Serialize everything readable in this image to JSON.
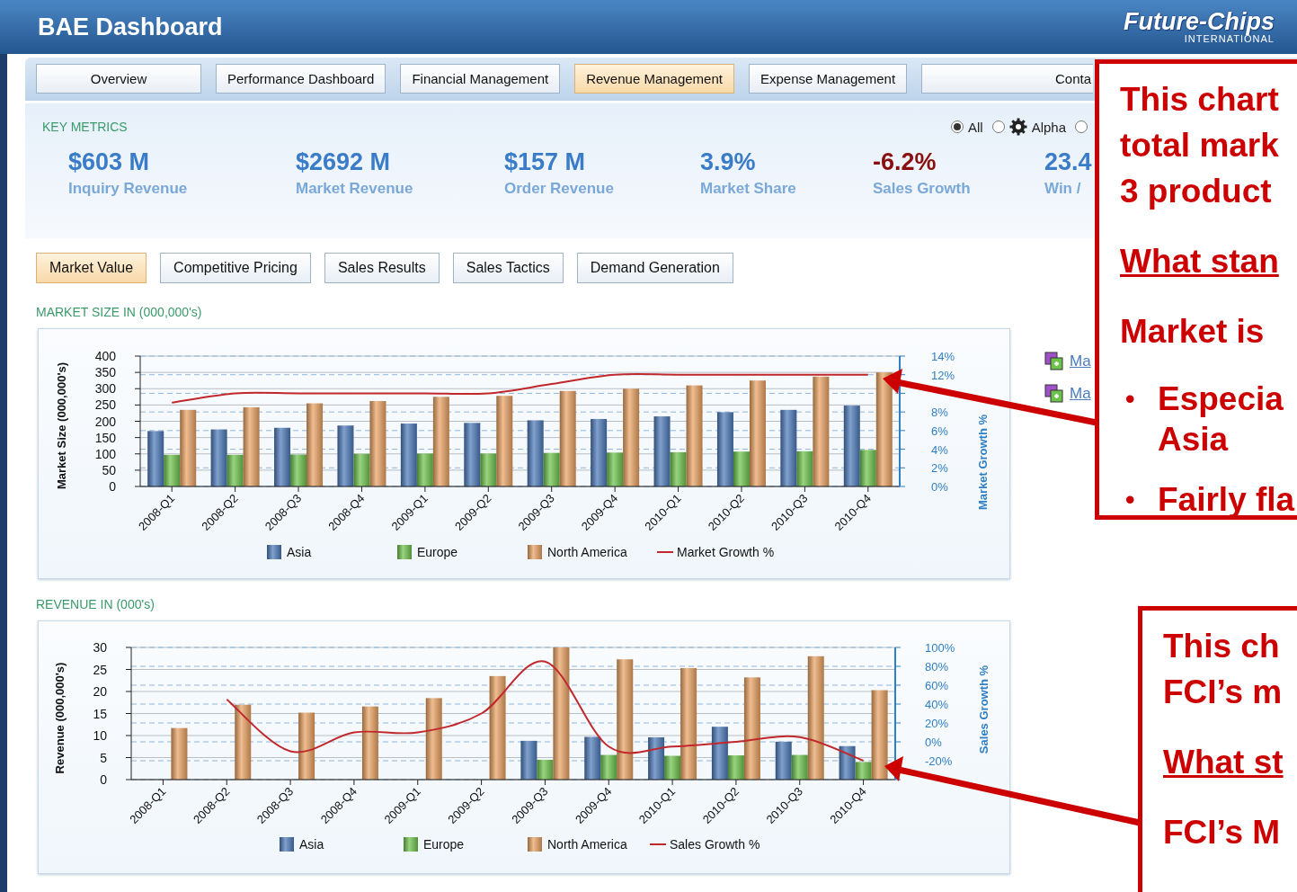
{
  "header": {
    "title": "BAE Dashboard",
    "logo": {
      "name": "Future-Chips",
      "subtitle": "INTERNATIONAL"
    }
  },
  "nav_tabs": [
    {
      "label": "Overview",
      "selected": false
    },
    {
      "label": "Performance Dashboard",
      "selected": false
    },
    {
      "label": "Financial Management",
      "selected": false
    },
    {
      "label": "Revenue Management",
      "selected": true
    },
    {
      "label": "Expense Management",
      "selected": false
    },
    {
      "label": "Conta",
      "selected": false
    }
  ],
  "key_metrics": {
    "title": "KEY METRICS",
    "filters": [
      {
        "label": "All",
        "selected": true
      },
      {
        "label": "Alpha",
        "selected": false,
        "icon": true
      },
      {
        "selected": false
      }
    ],
    "metrics": [
      {
        "value": "$603 M",
        "label": "Inquiry Revenue",
        "negative": false
      },
      {
        "value": "$2692 M",
        "label": "Market Revenue",
        "negative": false
      },
      {
        "value": "$157 M",
        "label": "Order Revenue",
        "negative": false
      },
      {
        "value": "3.9%",
        "label": "Market Share",
        "negative": false
      },
      {
        "value": "-6.2%",
        "label": "Sales Growth",
        "negative": true
      },
      {
        "value": "23.4",
        "label": "Win /",
        "negative": false
      }
    ]
  },
  "sub_tabs": [
    {
      "label": "Market Value",
      "selected": true
    },
    {
      "label": "Competitive Pricing",
      "selected": false
    },
    {
      "label": "Sales Results",
      "selected": false
    },
    {
      "label": "Sales Tactics",
      "selected": false
    },
    {
      "label": "Demand Generation",
      "selected": false
    }
  ],
  "sections": [
    {
      "label": "MARKET SIZE IN (000,000's)",
      "links": [
        "Ma",
        "Ma"
      ],
      "chart_data": {
        "type": "bar",
        "stacked": false,
        "grid": true,
        "legend": "bottom",
        "ylabel": "Market Size (000,000's)",
        "y2label": "Market Growth %",
        "categories": [
          "2008-Q1",
          "2008-Q2",
          "2008-Q3",
          "2008-Q4",
          "2009-Q1",
          "2009-Q2",
          "2009-Q3",
          "2009-Q4",
          "2010-Q1",
          "2010-Q2",
          "2010-Q3",
          "2010-Q4"
        ],
        "ylim": [
          0,
          400
        ],
        "yticks": [
          0,
          50,
          100,
          150,
          200,
          250,
          300,
          350,
          400
        ],
        "y2lim": [
          0,
          14
        ],
        "y2ticks": [
          {
            "value": 0,
            "label": "0%"
          },
          {
            "value": 2,
            "label": "2%"
          },
          {
            "value": 4,
            "label": "4%"
          },
          {
            "value": 6,
            "label": "6%"
          },
          {
            "value": 8,
            "label": "8%"
          },
          {
            "value": 12,
            "label": "12%"
          },
          {
            "value": 14,
            "label": "14%"
          }
        ],
        "series": [
          {
            "name": "Asia",
            "color": "#4a78b8",
            "type": "bar",
            "values": [
              170,
              175,
              180,
              187,
              193,
              195,
              203,
              207,
              215,
              228,
              235,
              248
            ]
          },
          {
            "name": "Europe",
            "color": "#6cc24a",
            "type": "bar",
            "values": [
              97,
              97,
              98,
              100,
              101,
              101,
              103,
              104,
              105,
              107,
              108,
              112
            ]
          },
          {
            "name": "North America",
            "color": "#e8a060",
            "type": "bar",
            "values": [
              235,
              243,
              255,
              262,
              275,
              278,
              293,
              300,
              310,
              325,
              337,
              350
            ]
          },
          {
            "name": "Market Growth %",
            "color": "#c0282c",
            "type": "line",
            "axis": "y2",
            "values": [
              9,
              10,
              10,
              10,
              10,
              10,
              11,
              12,
              12,
              12,
              12,
              12
            ]
          }
        ]
      }
    },
    {
      "label": "REVENUE IN (000's)",
      "chart_data": {
        "type": "bar",
        "stacked": false,
        "grid": true,
        "legend": "bottom",
        "ylabel": "Revenue (000,000's)",
        "y2label": "Sales Growth %",
        "categories": [
          "2008-Q1",
          "2008-Q2",
          "2008-Q3",
          "2008-Q4",
          "2009-Q1",
          "2009-Q2",
          "2009-Q3",
          "2009-Q4",
          "2010-Q1",
          "2010-Q2",
          "2010-Q3",
          "2010-Q4"
        ],
        "ylim": [
          0,
          30
        ],
        "yticks": [
          0,
          5,
          10,
          15,
          20,
          25,
          30
        ],
        "y2lim": [
          -40,
          100
        ],
        "y2ticks": [
          {
            "value": -20,
            "label": "-20%"
          },
          {
            "value": 0,
            "label": "0%"
          },
          {
            "value": 20,
            "label": "20%"
          },
          {
            "value": 40,
            "label": "40%"
          },
          {
            "value": 60,
            "label": "60%"
          },
          {
            "value": 80,
            "label": "80%"
          },
          {
            "value": 100,
            "label": "100%"
          }
        ],
        "series": [
          {
            "name": "Asia",
            "color": "#4a78b8",
            "type": "bar",
            "values": [
              null,
              null,
              null,
              null,
              null,
              null,
              8.8,
              9.7,
              9.6,
              12,
              8.6,
              7.6
            ]
          },
          {
            "name": "Europe",
            "color": "#6cc24a",
            "type": "bar",
            "values": [
              null,
              null,
              null,
              null,
              null,
              null,
              4.5,
              5.6,
              5.4,
              5.5,
              5.6,
              4
            ]
          },
          {
            "name": "North America",
            "color": "#e8a060",
            "type": "bar",
            "values": [
              11.7,
              17,
              15.2,
              16.6,
              18.5,
              23.5,
              30,
              27.3,
              25.3,
              23.2,
              28,
              20.3
            ]
          },
          {
            "name": "Sales Growth %",
            "color": "#c0282c",
            "type": "line",
            "axis": "y2",
            "values": [
              null,
              45,
              -10,
              10,
              10,
              30,
              85,
              -5,
              -5,
              0,
              5,
              -20
            ]
          }
        ]
      }
    }
  ],
  "callouts": [
    {
      "paragraphs": [
        {
          "kind": "text",
          "lines": [
            "This chart",
            "total mark",
            "3 product"
          ]
        },
        {
          "kind": "underlined",
          "lines": [
            "What stan"
          ]
        },
        {
          "kind": "text",
          "lines": [
            "Market is"
          ]
        },
        {
          "kind": "bullet",
          "bullet": "•",
          "lines": [
            "Especia",
            "Asia"
          ]
        },
        {
          "kind": "bullet",
          "bullet": "•",
          "lines": [
            "Fairly fla"
          ]
        }
      ]
    },
    {
      "paragraphs": [
        {
          "kind": "text",
          "lines": [
            "This ch",
            "FCI’s m"
          ]
        },
        {
          "kind": "underlined",
          "lines": [
            "What st"
          ]
        },
        {
          "kind": "text",
          "lines": [
            "FCI’s M"
          ]
        }
      ]
    }
  ]
}
